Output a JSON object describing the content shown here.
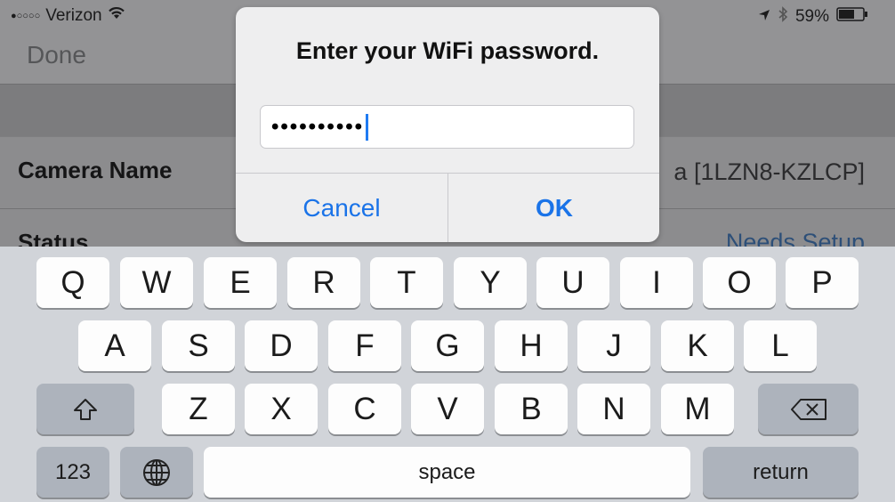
{
  "status_bar": {
    "signal": "●○○○○",
    "carrier": "Verizon",
    "battery": "59%"
  },
  "nav": {
    "done_label": "Done"
  },
  "settings": {
    "camera_name_label": "Camera Name",
    "camera_name_value": "a [1LZN8-KZLCP]",
    "status_label": "Status",
    "status_value": "Needs Setup"
  },
  "alert": {
    "title": "Enter your WiFi password.",
    "password_mask": "••••••••••",
    "cancel_label": "Cancel",
    "ok_label": "OK"
  },
  "keyboard": {
    "row1": [
      "Q",
      "W",
      "E",
      "R",
      "T",
      "Y",
      "U",
      "I",
      "O",
      "P"
    ],
    "row2": [
      "A",
      "S",
      "D",
      "F",
      "G",
      "H",
      "J",
      "K",
      "L"
    ],
    "row3": [
      "Z",
      "X",
      "C",
      "V",
      "B",
      "N",
      "M"
    ],
    "numbers_label": "123",
    "space_label": "space",
    "return_label": "return"
  },
  "colors": {
    "accent": "#1a73e8",
    "keyboard_bg": "#d1d4d9",
    "dim_overlay": "#7f7f81"
  },
  "icons": {
    "wifi": "wifi-icon",
    "location": "location-arrow-icon",
    "bluetooth": "bluetooth-icon",
    "battery": "battery-icon",
    "shift": "shift-icon",
    "delete": "backspace-icon",
    "globe": "globe-icon"
  }
}
